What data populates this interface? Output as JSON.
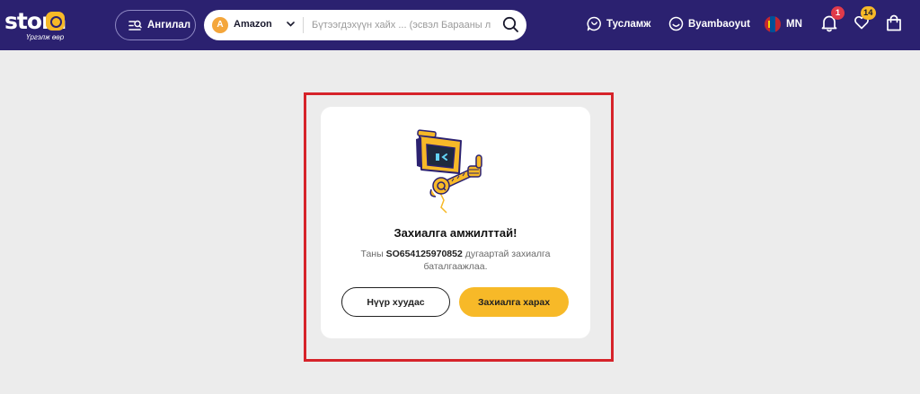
{
  "header": {
    "logo_text": "stora",
    "logo_tagline": "Үргэлж өөр",
    "category_label": "Ангилал",
    "search": {
      "store_initial": "A",
      "store_name": "Amazon",
      "placeholder": "Бүтээгдэхүүн хайх ... (эсвэл Барааны линк)"
    },
    "help_label": "Тусламж",
    "user_name": "Byambaoyut",
    "language": "MN",
    "notifications_count": "1",
    "wishlist_count": "14"
  },
  "card": {
    "title": "Захиалга амжилттай!",
    "message_prefix": "Таны",
    "order_id": "SO654125970852",
    "message_suffix": "дугаартай захиалга баталгаажлаа.",
    "home_button": "Нүүр хуудас",
    "view_order_button": "Захиалга харах"
  },
  "colors": {
    "header_bg": "#2b2170",
    "accent": "#f7b928",
    "highlight_border": "#d6232a",
    "notification_badge": "#e03a4a"
  },
  "icons": {
    "category": "category-search-icon",
    "search": "search-icon",
    "help": "chat-help-icon",
    "user": "smile-user-icon",
    "language": "mongolia-flag-icon",
    "notifications": "bell-icon",
    "wishlist": "heart-icon",
    "cart": "shopping-bag-icon",
    "illustration": "robot-thumbs-up-illustration"
  }
}
